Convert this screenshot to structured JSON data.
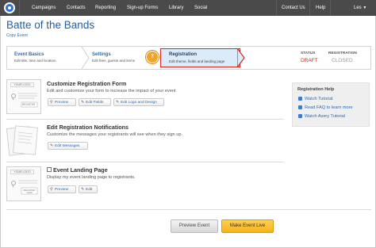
{
  "nav": {
    "items": [
      "Campaigns",
      "Contacts",
      "Reporting",
      "Sign-up Forms",
      "Library",
      "Social"
    ],
    "contact_us": "Contact Us",
    "help": "Help",
    "user": "Les"
  },
  "page": {
    "title": "Batte of the Bands",
    "copy_link": "Copy Event"
  },
  "steps": [
    {
      "title": "Event Basics",
      "desc": "Edit title, time and location"
    },
    {
      "title": "Settings",
      "desc": "Edit fees, guests and items"
    },
    {
      "title": "Registration",
      "desc": "Edit theme, fields and landing page",
      "badge": "7"
    }
  ],
  "status": {
    "status_label": "STATUS",
    "status_value": "DRAFT",
    "registration_label": "REGISTRATION",
    "registration_value": "CLOSED"
  },
  "sections": [
    {
      "title": "Customize Registration Form",
      "desc": "Edit and customize your form to increase the impact of your event",
      "thumb_header": "YOUR LOGO",
      "thumb_button": "REGISTER",
      "buttons": [
        "Preview",
        "Edit Fields",
        "Edit Logo and Design"
      ]
    },
    {
      "title": "Edit Registration Notifications",
      "desc": "Customize the messages your registrants will see when they sign up.",
      "buttons": [
        "Edit Messages"
      ]
    },
    {
      "title": "Event Landing Page",
      "desc": "Display my event landing page to registrants.",
      "thumb_header": "YOUR LOGO",
      "thumb_button": "REGISTER NOW",
      "buttons": [
        "Preview",
        "Edit"
      ]
    }
  ],
  "help": {
    "title": "Registration Help",
    "links": [
      "Watch Tutorial",
      "Read FAQ to learn more",
      "Watch Avery Tutorial"
    ]
  },
  "actions": {
    "preview": "Preview Event",
    "live": "Make Event Live"
  },
  "colors": {
    "nav_bg": "#4a4a4a",
    "link": "#2b6cb0",
    "draft": "#e2231a",
    "highlight_border": "#d6281e",
    "live_button": "#f7b21c",
    "badge": "#f0a52c"
  }
}
